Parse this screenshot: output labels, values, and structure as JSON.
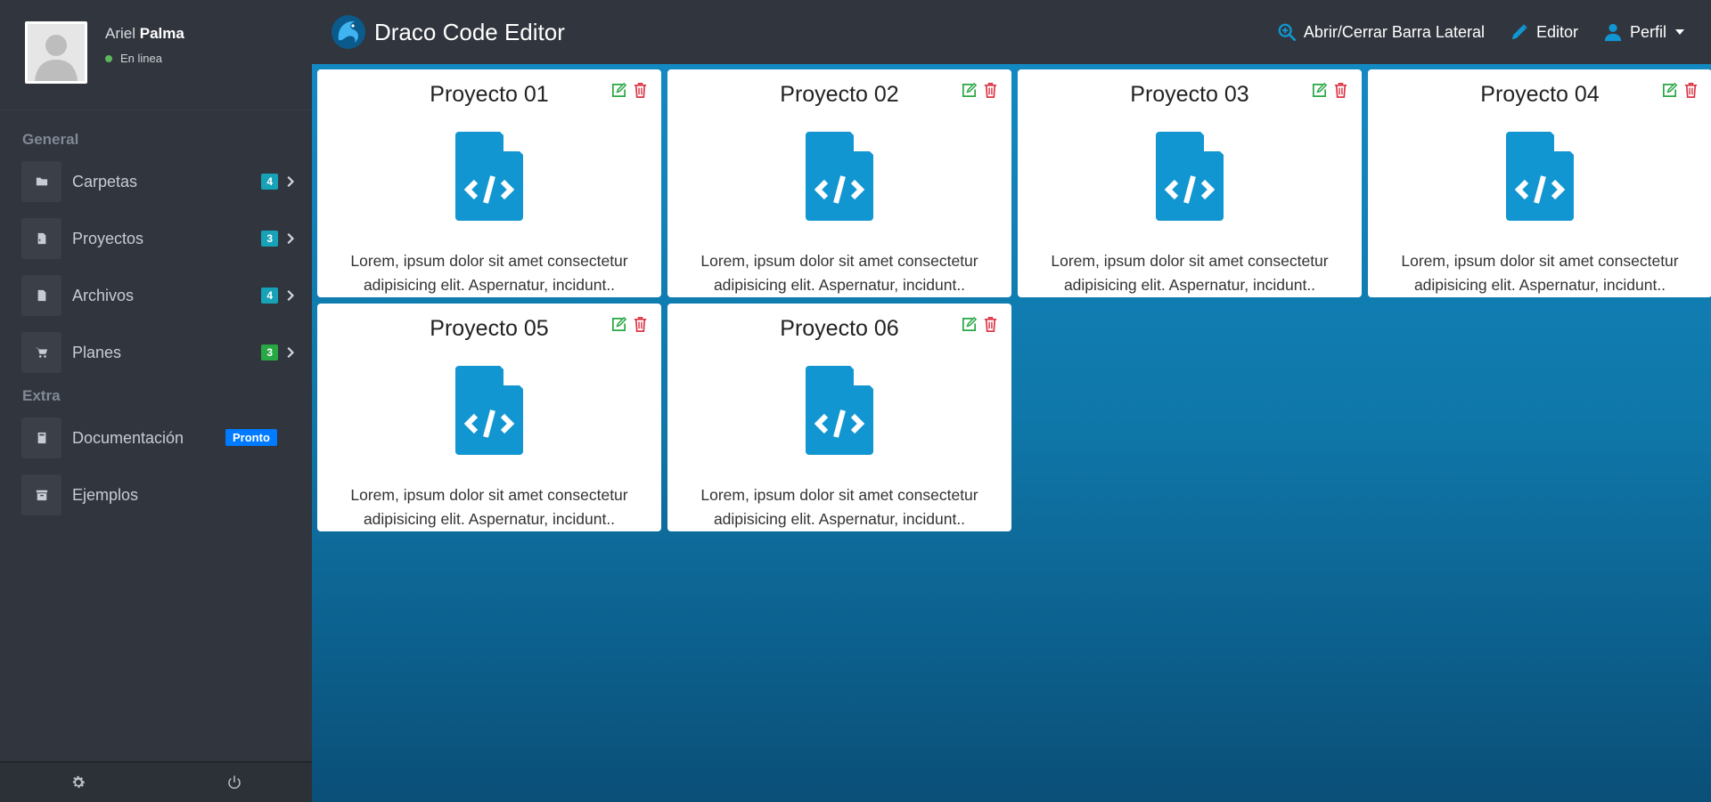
{
  "user": {
    "first_name": "Ariel",
    "last_name": "Palma",
    "status": "En linea"
  },
  "sidebar": {
    "sections": [
      {
        "title": "General",
        "items": [
          {
            "label": "Carpetas",
            "icon": "folder-icon",
            "badge": "4",
            "badge_color": "#17a2b8"
          },
          {
            "label": "Proyectos",
            "icon": "file-code-icon",
            "badge": "3",
            "badge_color": "#17a2b8"
          },
          {
            "label": "Archivos",
            "icon": "file-icon",
            "badge": "4",
            "badge_color": "#17a2b8"
          },
          {
            "label": "Planes",
            "icon": "cart-icon",
            "badge": "3",
            "badge_color": "#28a745"
          }
        ]
      },
      {
        "title": "Extra",
        "items": [
          {
            "label": "Documentación",
            "icon": "book-icon",
            "tag": "Pronto"
          },
          {
            "label": "Ejemplos",
            "icon": "archive-icon"
          }
        ]
      }
    ],
    "footer": [
      "gear-icon",
      "power-icon"
    ]
  },
  "header": {
    "title": "Draco Code Editor",
    "nav": {
      "toggle_sidebar": "Abrir/Cerrar Barra Lateral",
      "editor": "Editor",
      "profile": "Perfil"
    }
  },
  "projects": [
    {
      "title": "Proyecto 01",
      "description": "Lorem, ipsum dolor sit amet consectetur adipisicing elit. Aspernatur, incidunt.."
    },
    {
      "title": "Proyecto 02",
      "description": "Lorem, ipsum dolor sit amet consectetur adipisicing elit. Aspernatur, incidunt.."
    },
    {
      "title": "Proyecto 03",
      "description": "Lorem, ipsum dolor sit amet consectetur adipisicing elit. Aspernatur, incidunt.."
    },
    {
      "title": "Proyecto 04",
      "description": "Lorem, ipsum dolor sit amet consectetur adipisicing elit. Aspernatur, incidunt.."
    },
    {
      "title": "Proyecto 05",
      "description": "Lorem, ipsum dolor sit amet consectetur adipisicing elit. Aspernatur, incidunt.."
    },
    {
      "title": "Proyecto 06",
      "description": "Lorem, ipsum dolor sit amet consectetur adipisicing elit. Aspernatur, incidunt.."
    }
  ],
  "colors": {
    "accent": "#1296d1",
    "edit": "#28a745",
    "delete": "#dc3545"
  }
}
